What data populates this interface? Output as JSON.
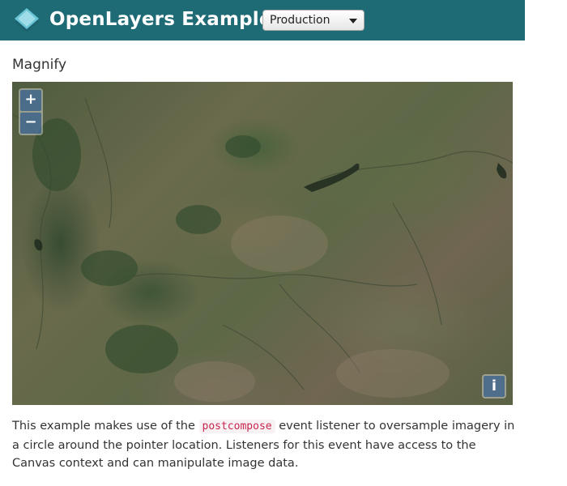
{
  "header": {
    "brand": "OpenLayers Examples",
    "logo_icon": "openlayers-logo-icon",
    "version_select": {
      "value": "Production"
    }
  },
  "page": {
    "title": "Magnify"
  },
  "map": {
    "zoom_in_label": "+",
    "zoom_out_label": "−",
    "attribution_label": "i"
  },
  "description": {
    "text_before": "This example makes use of the ",
    "code": "postcompose",
    "text_after": " event listener to oversample imagery in a circle around the pointer location. Listeners for this event have access to the Canvas context and can manipulate image data."
  },
  "colors": {
    "navbar": "#1f6b75",
    "code_text": "#c7254e",
    "control_button": "#003c88"
  }
}
